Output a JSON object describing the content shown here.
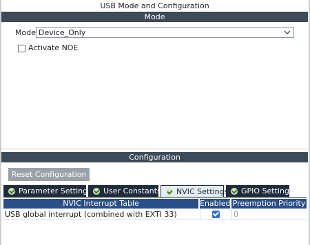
{
  "window": {
    "title": "USB Mode and Configuration"
  },
  "mode_section": {
    "header": "Mode",
    "mode_label": "Mode",
    "mode_value": "Device_Only",
    "activate_noe_label": "Activate NOE",
    "activate_noe_checked": false
  },
  "config_section": {
    "header": "Configuration",
    "reset_button": "Reset Configuration",
    "tabs": [
      {
        "label": "Parameter Settings",
        "active": false
      },
      {
        "label": "User Constants",
        "active": false
      },
      {
        "label": "NVIC Settings",
        "active": true
      },
      {
        "label": "GPIO Settings",
        "active": false
      }
    ],
    "table": {
      "headers": [
        "NVIC Interrupt Table",
        "Enabled",
        "Preemption Priority"
      ],
      "rows": [
        {
          "name": "USB global interrupt (combined with EXTI 33)",
          "enabled": true,
          "priority": "0"
        }
      ]
    }
  },
  "colors": {
    "section_header_bg": "#3d4a57",
    "tab_bg": "#1e2c3c",
    "tab_active_bg": "#e4ecf3",
    "table_header_bg": "#2a4e8a",
    "checkbox_checked": "#2f6fd0",
    "button_bg": "#9aa2a9"
  },
  "icons": {
    "tab_icon": "check-circle-icon",
    "dropdown_icon": "chevron-down-icon"
  }
}
